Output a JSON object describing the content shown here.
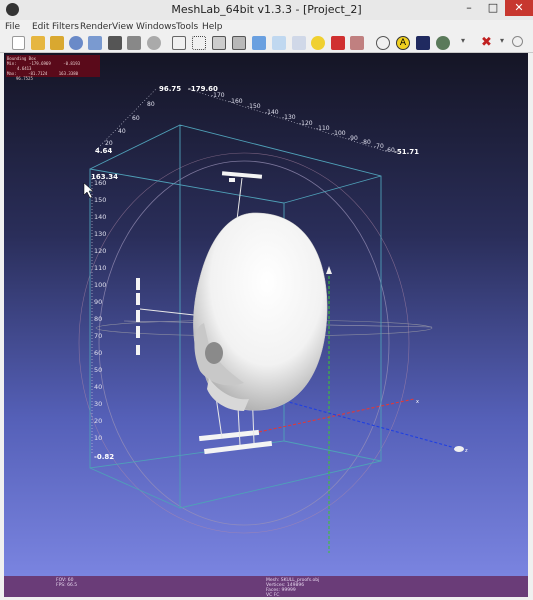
{
  "window": {
    "title": "MeshLab_64bit v1.3.3 - [Project_2]",
    "min_glyph": "–",
    "max_glyph": "□",
    "close_glyph": "✕"
  },
  "menu": [
    "File",
    "Edit",
    "Filters",
    "Render",
    "View",
    "Windows",
    "Tools",
    "Help"
  ],
  "bbox_info": {
    "title": "Bounding Box",
    "min_label": "Min:",
    "min_values": [
      "-179.6969",
      "-0.8193",
      "4.6413"
    ],
    "max_label": "Max:",
    "max_values": [
      "-81.7124",
      "163.3380",
      "96.7525"
    ]
  },
  "axis_ruler_labels": {
    "top_left_start": "96.75",
    "top_left_end": "4.64",
    "top_right_start": "-179.60",
    "top_right_end": "-51.71",
    "vertical_top": "163.34",
    "vertical_bottom": "-0.82"
  },
  "diag_ticks": [
    "20",
    "40",
    "60",
    "80"
  ],
  "top_ticks": [
    "-170",
    "-160",
    "-150",
    "-140",
    "-130",
    "-120",
    "-110",
    "-100",
    "-90",
    "-80",
    "-70",
    "-60"
  ],
  "vertical_ticks": [
    "160",
    "150",
    "140",
    "130",
    "120",
    "110",
    "100",
    "90",
    "80",
    "70",
    "60",
    "50",
    "40",
    "30",
    "20",
    "10"
  ],
  "axis_markers": {
    "x": "x",
    "z": "z"
  },
  "status": {
    "fov": "FOV: 60",
    "fps": "FPS:   66.5",
    "mesh": "Mesh: SKULL_proofs.obj",
    "vertices": "Vertices: 149896",
    "faces": "Faces: 99999",
    "extra": "VC FC"
  }
}
